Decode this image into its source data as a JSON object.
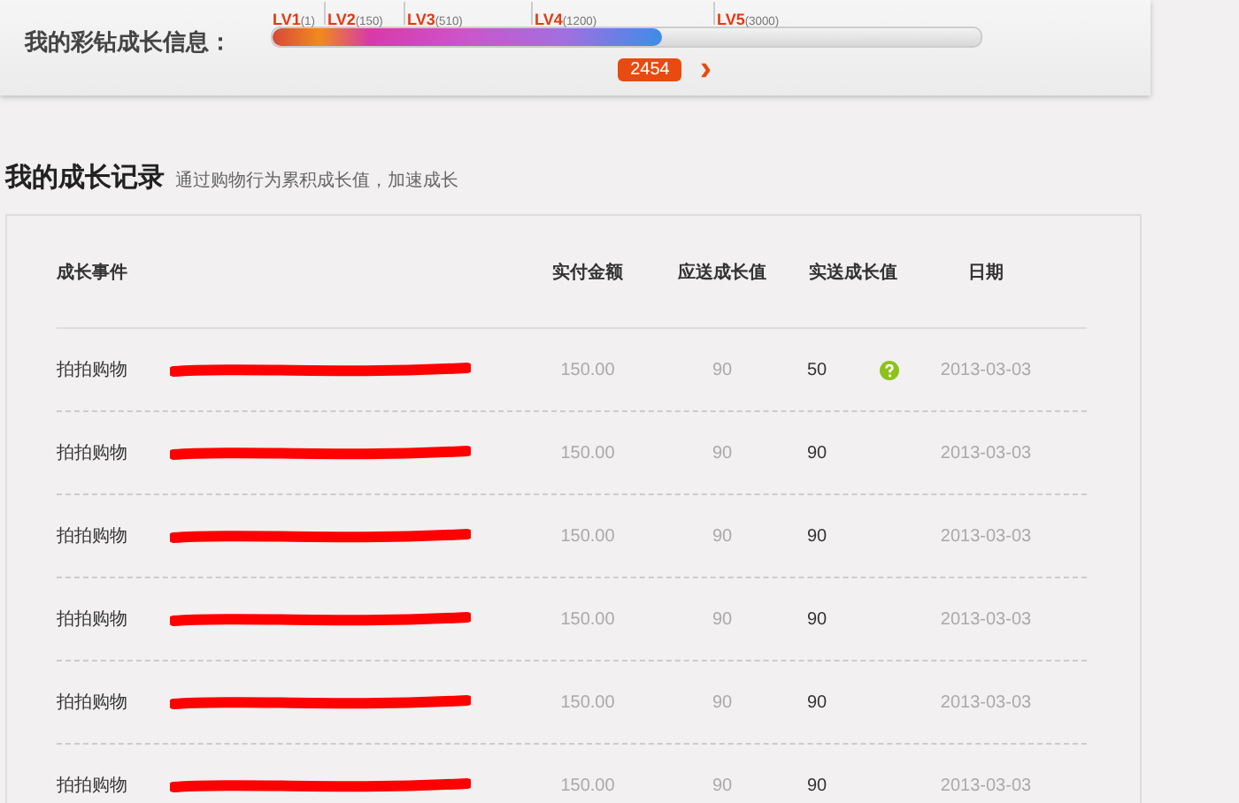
{
  "growth_info": {
    "label": "我的彩钻成长信息：",
    "levels": [
      {
        "name": "LV1",
        "threshold": "(1)"
      },
      {
        "name": "LV2",
        "threshold": "(150)"
      },
      {
        "name": "LV3",
        "threshold": "(510)"
      },
      {
        "name": "LV4",
        "threshold": "(1200)"
      },
      {
        "name": "LV5",
        "threshold": "(3000)"
      }
    ],
    "level": 0.55,
    "current_value": "2454",
    "next_arrow": "›"
  },
  "records": {
    "title": "我的成长记录",
    "subtitle": "通过购物行为累积成长值，加速成长",
    "columns": [
      "成长事件",
      "实付金额",
      "应送成长值",
      "实送成长值",
      "日期"
    ],
    "rows": [
      {
        "event": "拍拍购物",
        "amount": "150.00",
        "expected": "90",
        "actual": "50",
        "has_note": true,
        "date": "2013-03-03"
      },
      {
        "event": "拍拍购物",
        "amount": "150.00",
        "expected": "90",
        "actual": "90",
        "has_note": false,
        "date": "2013-03-03"
      },
      {
        "event": "拍拍购物",
        "amount": "150.00",
        "expected": "90",
        "actual": "90",
        "has_note": false,
        "date": "2013-03-03"
      },
      {
        "event": "拍拍购物",
        "amount": "150.00",
        "expected": "90",
        "actual": "90",
        "has_note": false,
        "date": "2013-03-03"
      },
      {
        "event": "拍拍购物",
        "amount": "150.00",
        "expected": "90",
        "actual": "90",
        "has_note": false,
        "date": "2013-03-03"
      },
      {
        "event": "拍拍购物",
        "amount": "150.00",
        "expected": "90",
        "actual": "90",
        "has_note": false,
        "date": "2013-03-03"
      }
    ]
  }
}
